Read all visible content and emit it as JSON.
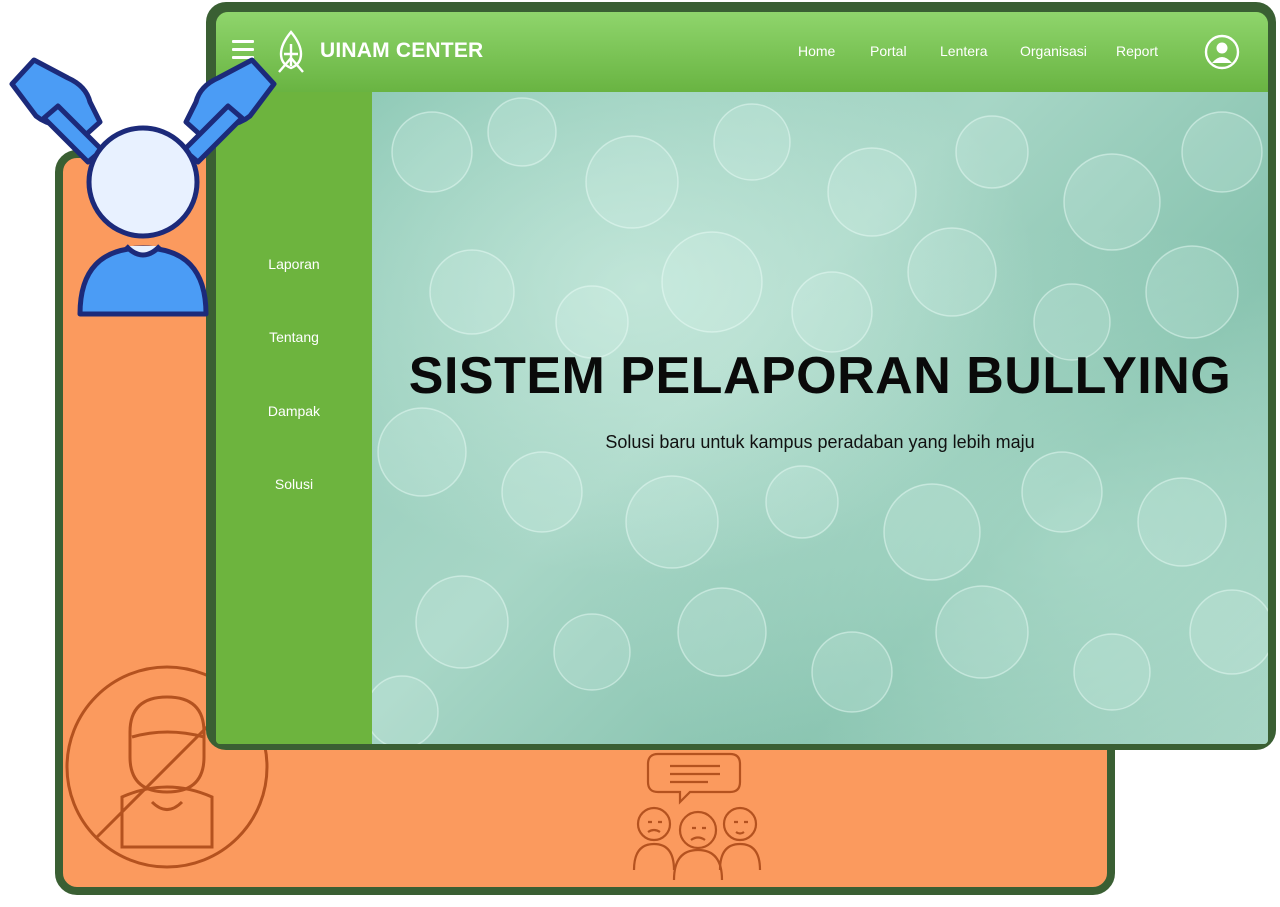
{
  "brand": {
    "name": "UINAM CENTER",
    "logo_icon": "uinam-logo-icon"
  },
  "navbar": {
    "menu_icon": "hamburger-menu-icon",
    "links": [
      {
        "label": "Home"
      },
      {
        "label": "Portal"
      },
      {
        "label": "Lentera"
      },
      {
        "label": "Organisasi"
      },
      {
        "label": "Report"
      }
    ],
    "user_icon": "user-account-icon"
  },
  "sidebar": {
    "items": [
      {
        "label": "Laporan"
      },
      {
        "label": "Tentang"
      },
      {
        "label": "Dampak"
      },
      {
        "label": "Solusi"
      }
    ]
  },
  "hero": {
    "title": "SISTEM PELAPORAN BULLYING",
    "subtitle": "Solusi baru untuk kampus peradaban yang lebih maju"
  },
  "decorations": {
    "pointing_illustration": "pointing-hands-at-person-icon",
    "no_person_sign": "no-bullying-person-icon",
    "group_chat": "upset-group-chat-icon"
  },
  "colors": {
    "navbar": "#7cc555",
    "sidebar": "#6db43e",
    "frame": "#3a5f33",
    "back_panel": "#fb9a5e",
    "hand_blue": "#4b9cf5",
    "outline_navy": "#1c2a7a"
  }
}
